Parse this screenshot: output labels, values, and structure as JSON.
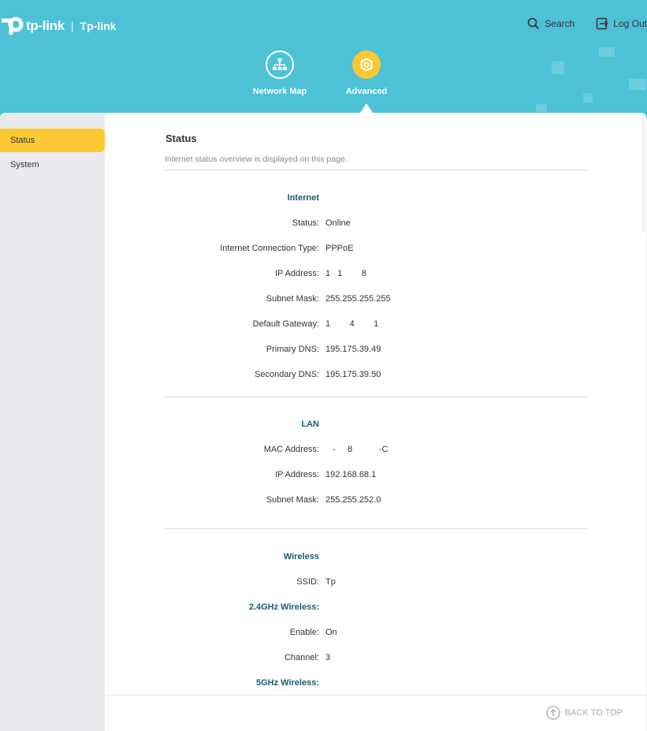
{
  "header": {
    "brand": "tp-link",
    "separator": "|",
    "device_name": "Tp-link",
    "search_label": "Search",
    "logout_label": "Log Out",
    "nav": [
      {
        "label": "Network Map",
        "icon": "network-map-icon"
      },
      {
        "label": "Advanced",
        "icon": "gear-icon"
      }
    ]
  },
  "colors": {
    "header_bg": "#4dc1d6",
    "accent": "#fcc934",
    "section_title": "#1e5a72"
  },
  "sidebar": {
    "items": [
      {
        "label": "Status",
        "active": true
      },
      {
        "label": "System",
        "active": false
      }
    ]
  },
  "main": {
    "title": "Status",
    "description": "Internet status overview is displayed on this page.",
    "internet": {
      "title": "Internet",
      "status_label": "Status:",
      "status_value": "Online",
      "conn_type_label": "Internet Connection Type:",
      "conn_type_value": "PPPoE",
      "ip_label": "IP Address:",
      "ip_value": "1   1        8",
      "mask_label": "Subnet Mask:",
      "mask_value": "255.255.255.255",
      "gateway_label": "Default Gateway:",
      "gateway_value": "1        4        1",
      "dns1_label": "Primary DNS:",
      "dns1_value": "195.175.39.49",
      "dns2_label": "Secondary DNS:",
      "dns2_value": "195.175.39.50"
    },
    "lan": {
      "title": "LAN",
      "mac_label": "MAC Address:",
      "mac_value": "   -     8           -C",
      "ip_label": "IP Address:",
      "ip_value": "192.168.68.1",
      "mask_label": "Subnet Mask:",
      "mask_value": "255.255.252.0"
    },
    "wireless": {
      "title": "Wireless",
      "ssid_label": "SSID:",
      "ssid_value": "Tp",
      "band24_title": "2.4GHz Wireless:",
      "enable_label": "Enable:",
      "enable_value": "On",
      "channel_label": "Channel:",
      "channel_value": "3",
      "band5_title": "5GHz Wireless:"
    }
  },
  "footer": {
    "back_to_top": "BACK TO TOP"
  }
}
